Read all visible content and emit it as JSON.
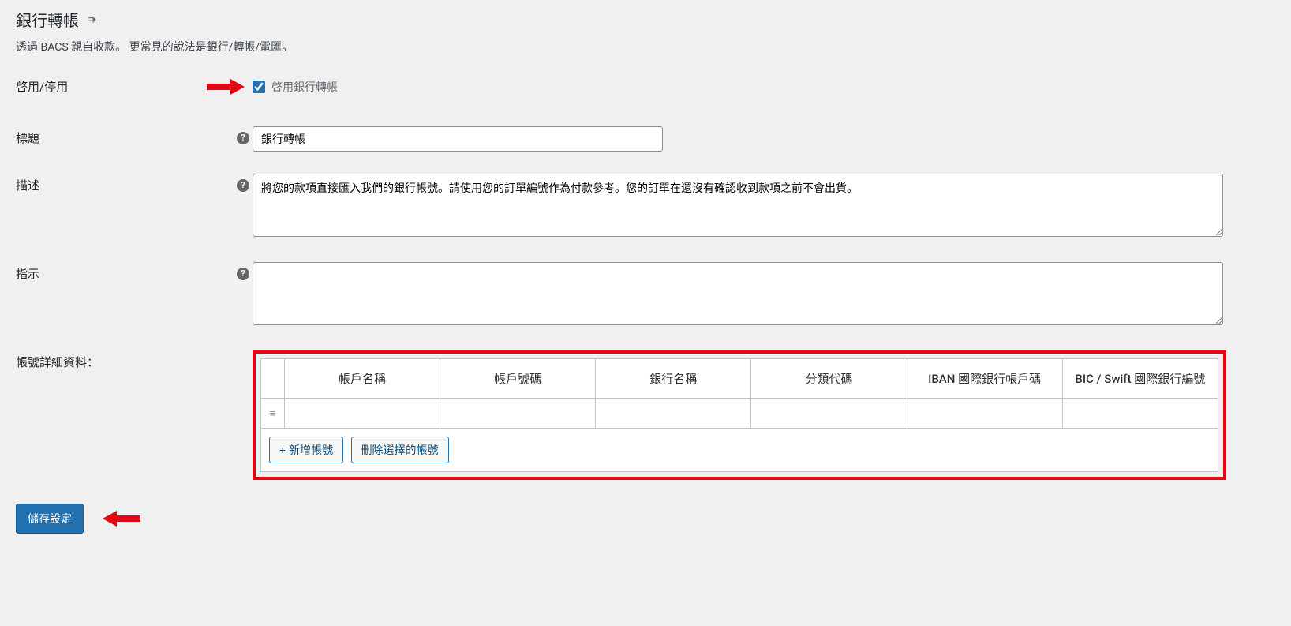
{
  "page": {
    "title": "銀行轉帳",
    "subtitle": "透過 BACS 親自收款。 更常見的說法是銀行/轉帳/電匯。"
  },
  "fields": {
    "enable": {
      "label": "啓用/停用",
      "checkbox_label": "啓用銀行轉帳"
    },
    "title": {
      "label": "標題",
      "value": "銀行轉帳"
    },
    "description": {
      "label": "描述",
      "value": "將您的款項直接匯入我們的銀行帳號。請使用您的訂單編號作為付款參考。您的訂單在還沒有確認收到款項之前不會出貨。"
    },
    "instructions": {
      "label": "指示",
      "value": ""
    },
    "accounts": {
      "label": "帳號詳細資料：",
      "headers": [
        "帳戶名稱",
        "帳戶號碼",
        "銀行名稱",
        "分類代碼",
        "IBAN 國際銀行帳戶碼",
        "BIC / Swift 國際銀行編號"
      ],
      "rows": [
        {
          "account_name": "",
          "account_number": "",
          "bank_name": "",
          "sort_code": "",
          "iban": "",
          "bic": ""
        }
      ],
      "add_button": "+ 新增帳號",
      "remove_button": "刪除選擇的帳號"
    }
  },
  "buttons": {
    "save": "儲存設定"
  }
}
